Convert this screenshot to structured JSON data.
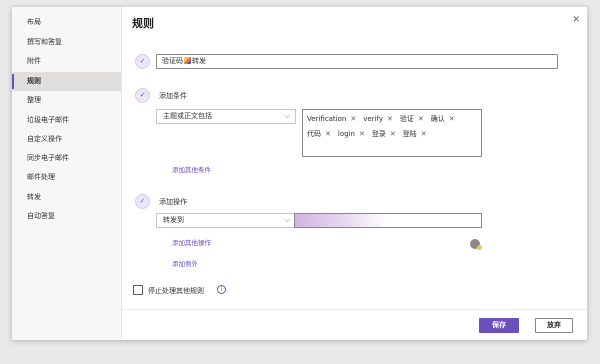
{
  "sidebar": {
    "items": [
      {
        "label": "布局"
      },
      {
        "label": "撰写和答复"
      },
      {
        "label": "附件"
      },
      {
        "label": "规则",
        "active": true
      },
      {
        "label": "整理"
      },
      {
        "label": "垃圾电子邮件"
      },
      {
        "label": "自定义操作"
      },
      {
        "label": "同步电子邮件"
      },
      {
        "label": "邮件处理"
      },
      {
        "label": "转发"
      },
      {
        "label": "自动答复"
      }
    ]
  },
  "header": {
    "title": "规则",
    "close_icon": "close-icon"
  },
  "rule": {
    "name_prefix": "验证码",
    "name_suffix": "转发",
    "condition": {
      "label": "添加条件",
      "selected": "主题或正文包括",
      "tags": [
        "Verification",
        "verify",
        "验证",
        "确认",
        "代码",
        "login",
        "登录",
        "登陆"
      ],
      "add_link": "添加其他条件"
    },
    "action": {
      "label": "添加操作",
      "selected": "转发到",
      "add_link": "添加其他操作",
      "exception_link": "添加例外"
    },
    "stop_processing_label": "停止处理其他规则",
    "info_glyph": "i"
  },
  "footer": {
    "save_label": "保存",
    "discard_label": "放弃"
  },
  "colors": {
    "accent": "#6b4fbb"
  }
}
